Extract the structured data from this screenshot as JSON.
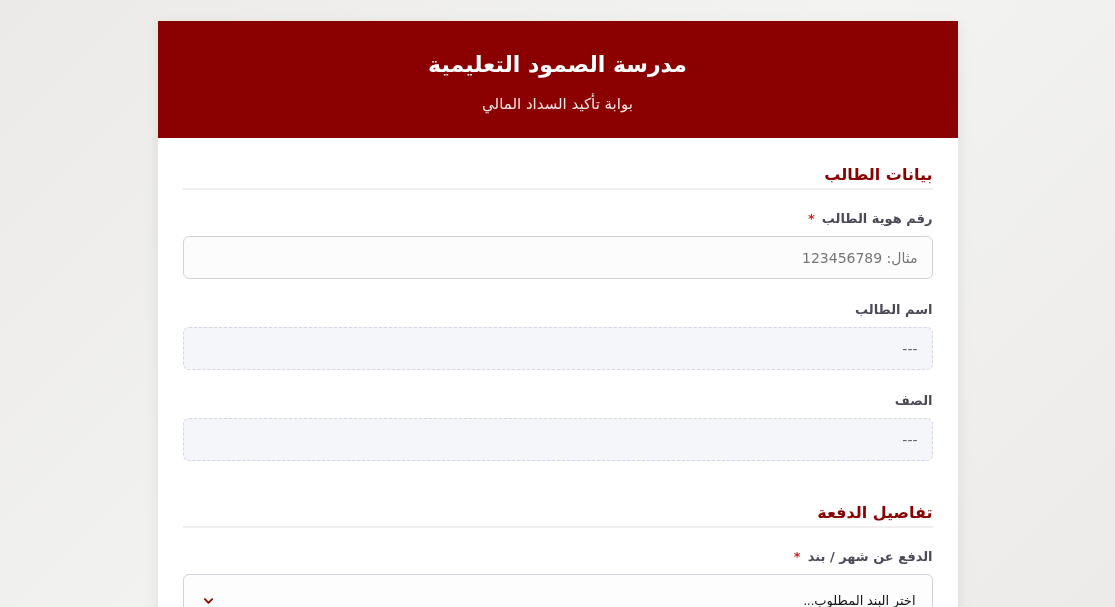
{
  "header": {
    "title": "مدرسة الصمود التعليمية",
    "subtitle": "بوابة تأكيد السداد المالي"
  },
  "sections": [
    {
      "title": "بيانات الطالب",
      "fields": [
        {
          "kind": "input",
          "label": "رقم هوية الطالب",
          "asterisk": "*",
          "placeholder": "مثال: 123456789"
        },
        {
          "kind": "readonly",
          "label": "اسم الطالب",
          "value": "---"
        },
        {
          "kind": "readonly",
          "label": "الصف",
          "value": "---"
        }
      ]
    },
    {
      "title": "تفاصيل الدفعة",
      "fields": [
        {
          "kind": "select",
          "label": "الدفع عن شهر / بند",
          "asterisk": "*",
          "value": "اختر البند المطلوب..."
        }
      ]
    }
  ]
}
